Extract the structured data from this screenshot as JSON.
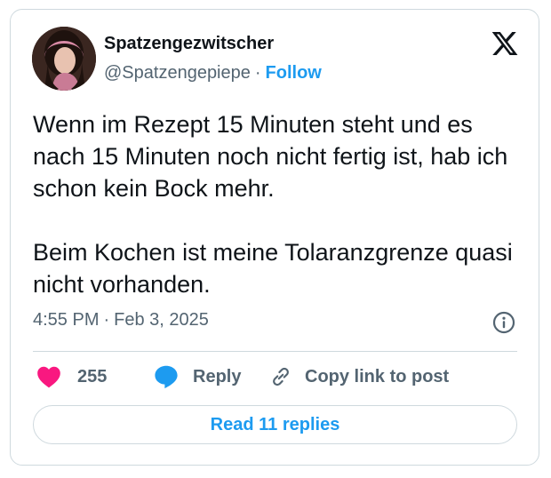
{
  "author": {
    "name": "Spatzengezwitscher",
    "handle": "@Spatzengepiepe",
    "separator": "·",
    "follow_label": "Follow"
  },
  "tweet": {
    "paragraphs": [
      "Wenn im Rezept 15 Minuten steht und es nach 15 Minuten noch nicht fertig ist, hab ich schon kein Bock mehr.",
      "Beim Kochen ist meine Tolaranzgrenze quasi nicht vorhanden."
    ],
    "time": "4:55 PM",
    "separator": "·",
    "date": "Feb 3, 2025"
  },
  "actions": {
    "like_count": "255",
    "reply_label": "Reply",
    "copy_label": "Copy link to post"
  },
  "read_replies_label": "Read 11 replies",
  "icons": {
    "brand": "x-logo-icon",
    "info": "info-icon",
    "like": "heart-icon",
    "reply": "speech-bubble-icon",
    "copy": "link-icon"
  },
  "colors": {
    "accent": "#1d9bf0",
    "like": "#f91880",
    "text": "#0f1419",
    "secondary": "#536471",
    "border": "#cfd9de"
  }
}
